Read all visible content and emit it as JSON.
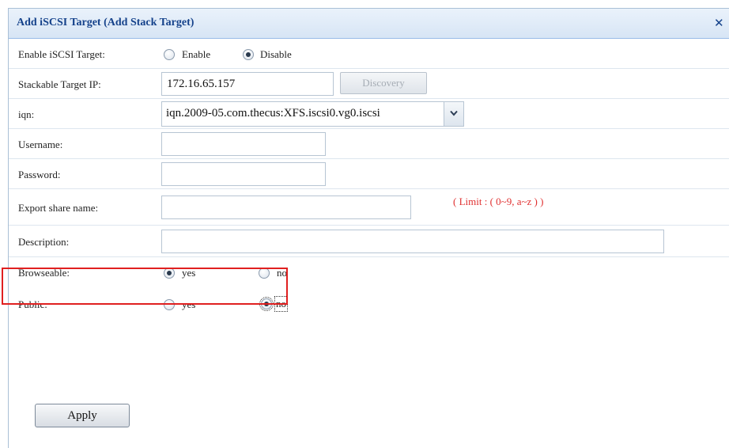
{
  "dialog": {
    "title": "Add iSCSI Target (Add Stack Target)",
    "close_glyph": "✕"
  },
  "form": {
    "enable_target": {
      "label": "Enable iSCSI Target:",
      "options": [
        {
          "label": "Enable",
          "checked": false
        },
        {
          "label": "Disable",
          "checked": true
        }
      ]
    },
    "stackable_ip": {
      "label": "Stackable Target IP:",
      "value": "172.16.65.157",
      "discovery_label": "Discovery"
    },
    "iqn": {
      "label": "iqn:",
      "selected": "iqn.2009-05.com.thecus:XFS.iscsi0.vg0.iscsi"
    },
    "username": {
      "label": "Username:",
      "value": ""
    },
    "password": {
      "label": "Password:",
      "value": ""
    },
    "export_share": {
      "label": "Export share name:",
      "value": "",
      "hint": "( Limit : ( 0~9, a~z ) )"
    },
    "description": {
      "label": "Description:",
      "value": ""
    },
    "browseable": {
      "label": "Browseable:",
      "options": [
        {
          "label": "yes",
          "checked": true
        },
        {
          "label": "no",
          "checked": false
        }
      ]
    },
    "public": {
      "label": "Public:",
      "options": [
        {
          "label": "yes",
          "checked": false
        },
        {
          "label": "no",
          "checked": true
        }
      ]
    }
  },
  "actions": {
    "apply_label": "Apply"
  },
  "colors": {
    "title_text": "#15428b",
    "hint_text": "#e03030",
    "highlight_border": "#e02020"
  }
}
